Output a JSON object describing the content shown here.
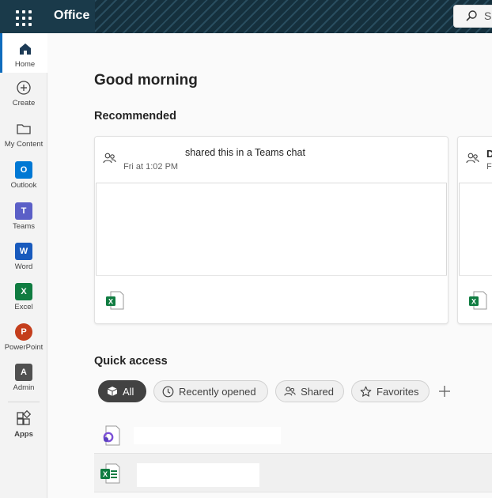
{
  "header": {
    "brand": "Office",
    "search_text": "Se"
  },
  "rail": {
    "items": [
      {
        "label": "Home",
        "icon": "home-icon",
        "active": true
      },
      {
        "label": "Create",
        "icon": "plus-circle-icon"
      },
      {
        "label": "My Content",
        "icon": "folder-icon"
      },
      {
        "label": "Outlook",
        "icon": "outlook-icon"
      },
      {
        "label": "Teams",
        "icon": "teams-icon"
      },
      {
        "label": "Word",
        "icon": "word-icon"
      },
      {
        "label": "Excel",
        "icon": "excel-icon"
      },
      {
        "label": "PowerPoint",
        "icon": "powerpoint-icon"
      },
      {
        "label": "Admin",
        "icon": "admin-icon"
      },
      {
        "label": "Apps",
        "icon": "apps-icon"
      }
    ]
  },
  "main": {
    "greeting": "Good morning",
    "recommended_heading": "Recommended",
    "recommended": [
      {
        "action": "shared this in a Teams chat",
        "time": "Fri at 1:02 PM",
        "file_type": "excel"
      },
      {
        "title_fragment": "D",
        "time_fragment": "Fr",
        "file_type": "excel"
      }
    ],
    "quick_access_heading": "Quick access",
    "filters": [
      {
        "label": "All",
        "selected": true
      },
      {
        "label": "Recently opened"
      },
      {
        "label": "Shared"
      },
      {
        "label": "Favorites"
      }
    ],
    "files": [
      {
        "file_type": "loop-icon"
      },
      {
        "file_type": "excel-icon"
      }
    ]
  },
  "colors": {
    "accent": "#0f6cbd",
    "topbar": "#1a3a4a",
    "excel": "#107c41",
    "word": "#185abd",
    "outlook": "#0078d4",
    "teams": "#5b5fc7",
    "powerpoint": "#c43e1c"
  }
}
